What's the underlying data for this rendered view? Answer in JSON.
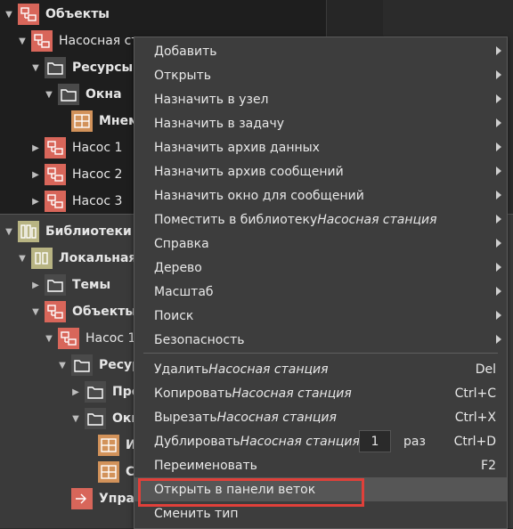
{
  "tree_top": [
    {
      "label": "Объекты",
      "icon": "object-icon",
      "arrow": "down",
      "indent": 0,
      "bold": true
    },
    {
      "label": "Насосная ст",
      "icon": "object-icon",
      "arrow": "down",
      "indent": 1,
      "bold": false
    },
    {
      "label": "Ресурсы",
      "icon": "folder-icon",
      "arrow": "down",
      "indent": 2,
      "bold": true
    },
    {
      "label": "Окна",
      "icon": "folder-icon",
      "arrow": "down",
      "indent": 3,
      "bold": true
    },
    {
      "label": "Мнем",
      "icon": "screen-icon",
      "arrow": "none",
      "indent": 4,
      "bold": true
    },
    {
      "label": "Насос 1",
      "icon": "object-icon",
      "arrow": "right",
      "indent": 2,
      "bold": false
    },
    {
      "label": "Насос 2",
      "icon": "object-icon",
      "arrow": "right",
      "indent": 2,
      "bold": false
    },
    {
      "label": "Насос 3",
      "icon": "object-icon",
      "arrow": "right",
      "indent": 2,
      "bold": false
    }
  ],
  "tree_bottom": [
    {
      "label": "Библиотеки",
      "icon": "library-icon",
      "arrow": "down",
      "indent": 0,
      "bold": true
    },
    {
      "label": "Локальная",
      "icon": "local-library-icon",
      "arrow": "down",
      "indent": 1,
      "bold": true
    },
    {
      "label": "Темы",
      "icon": "folder-icon",
      "arrow": "right",
      "indent": 2,
      "bold": true
    },
    {
      "label": "Объекты",
      "icon": "object-icon",
      "arrow": "down",
      "indent": 2,
      "bold": true
    },
    {
      "label": "Насос 1",
      "icon": "object-icon",
      "arrow": "down",
      "indent": 3,
      "bold": false
    },
    {
      "label": "Ресур",
      "icon": "folder-icon",
      "arrow": "down",
      "indent": 4,
      "bold": true
    },
    {
      "label": "Про",
      "icon": "folder-icon",
      "arrow": "right",
      "indent": 5,
      "bold": true
    },
    {
      "label": "Окн",
      "icon": "folder-icon",
      "arrow": "down",
      "indent": 5,
      "bold": true
    },
    {
      "label": "И",
      "icon": "screen-icon",
      "arrow": "none",
      "indent": 6,
      "bold": true
    },
    {
      "label": "С",
      "icon": "screen-icon",
      "arrow": "none",
      "indent": 6,
      "bold": true
    },
    {
      "label": "Упра",
      "icon": "rules-icon",
      "arrow": "none",
      "indent": 4,
      "bold": true
    }
  ],
  "menu": [
    {
      "label": "Добавить",
      "submenu": true
    },
    {
      "label": "Открыть",
      "submenu": true
    },
    {
      "label": "Назначить в узел",
      "submenu": true
    },
    {
      "label": "Назначить в задачу",
      "submenu": true
    },
    {
      "label": "Назначить архив данных",
      "submenu": true
    },
    {
      "label": "Назначить архив сообщений",
      "submenu": true
    },
    {
      "label": "Назначить окно для сообщений",
      "submenu": true
    },
    {
      "label": "Поместить в библиотеку ",
      "italic": "Насосная станция",
      "submenu": true
    },
    {
      "label": "Справка",
      "submenu": true
    },
    {
      "label": "Дерево",
      "submenu": true
    },
    {
      "label": "Масштаб",
      "submenu": true
    },
    {
      "label": "Поиск",
      "submenu": true
    },
    {
      "label": "Безопасность",
      "submenu": true
    },
    {
      "label": "Удалить ",
      "italic": "Насосная станция",
      "shortcut": "Del"
    },
    {
      "label": "Копировать ",
      "italic": "Насосная станция",
      "shortcut": "Ctrl+C"
    },
    {
      "label": "Вырезать ",
      "italic": "Насосная станция",
      "shortcut": "Ctrl+X"
    },
    {
      "label": "Дублировать ",
      "italic": "Насосная станция",
      "shortcut": "Ctrl+D",
      "spin_value": "1",
      "spin_unit": "раз"
    },
    {
      "label": "Переименовать",
      "shortcut": "F2"
    },
    {
      "label": "Открыть в панели веток",
      "highlighted": true
    },
    {
      "label": "Сменить тип"
    }
  ],
  "colors": {
    "highlight_box": "#e0403a",
    "object_icon": "#d8665a",
    "screen_icon": "#d2925a",
    "library_icon": "#b8b483"
  }
}
